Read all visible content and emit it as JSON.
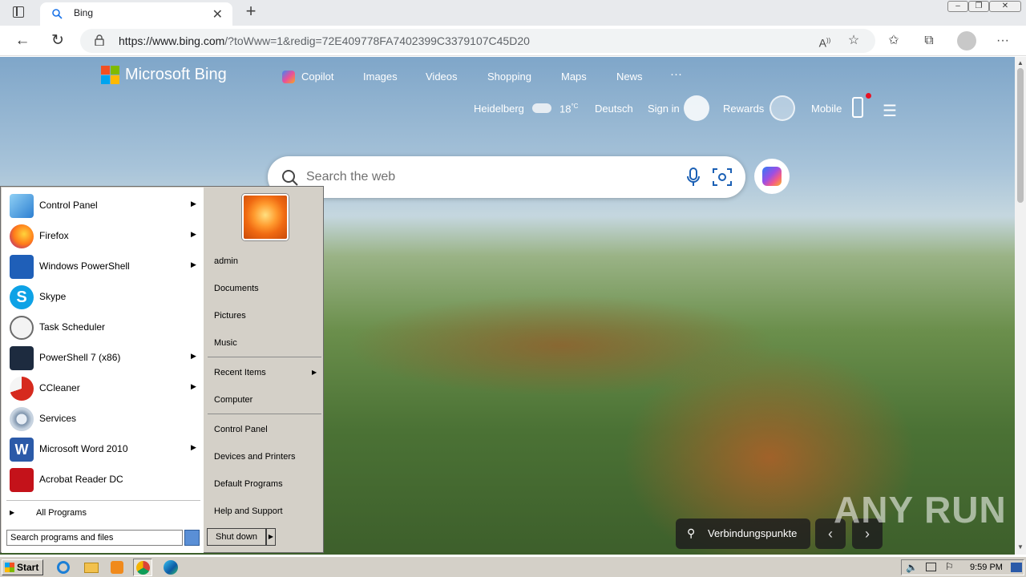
{
  "browser": {
    "tab_title": "Bing",
    "url_host": "https://www.bing.com",
    "url_rest": "/?toWww=1&redig=72E409778FA7402399C3379107C45D20",
    "new_tab": "+",
    "close_tab": "✕"
  },
  "bing": {
    "logo_text": "Microsoft Bing",
    "nav": [
      "Copilot",
      "Images",
      "Videos",
      "Shopping",
      "Maps",
      "News",
      "···"
    ],
    "location": "Heidelberg",
    "temperature": "18",
    "temp_unit": "°C",
    "language": "Deutsch",
    "sign_in": "Sign in",
    "rewards": "Rewards",
    "mobile": "Mobile",
    "search_placeholder": "Search the web",
    "location_label": "Verbindungspunkte",
    "watermark": "ANY  RUN"
  },
  "start_menu": {
    "programs": [
      {
        "label": "Control Panel",
        "icon": "control-panel-icon",
        "submenu": true
      },
      {
        "label": "Firefox",
        "icon": "firefox-icon",
        "submenu": true
      },
      {
        "label": "Windows PowerShell",
        "icon": "powershell-icon",
        "submenu": true
      },
      {
        "label": "Skype",
        "icon": "skype-icon",
        "submenu": false
      },
      {
        "label": "Task Scheduler",
        "icon": "task-scheduler-icon",
        "submenu": false
      },
      {
        "label": "PowerShell 7 (x86)",
        "icon": "powershell7-icon",
        "submenu": true
      },
      {
        "label": "CCleaner",
        "icon": "ccleaner-icon",
        "submenu": true
      },
      {
        "label": "Services",
        "icon": "services-icon",
        "submenu": false
      },
      {
        "label": "Microsoft Word 2010",
        "icon": "word-icon",
        "submenu": true
      },
      {
        "label": "Acrobat Reader DC",
        "icon": "acrobat-icon",
        "submenu": false
      }
    ],
    "all_programs": "All Programs",
    "search_placeholder": "Search programs and files",
    "right_links": [
      "admin",
      "Documents",
      "Pictures",
      "Music",
      "Recent Items",
      "Computer",
      "Control Panel",
      "Devices and Printers",
      "Default Programs",
      "Help and Support"
    ],
    "shutdown": "Shut down"
  },
  "taskbar": {
    "start": "Start",
    "clock": "9:59 PM"
  }
}
